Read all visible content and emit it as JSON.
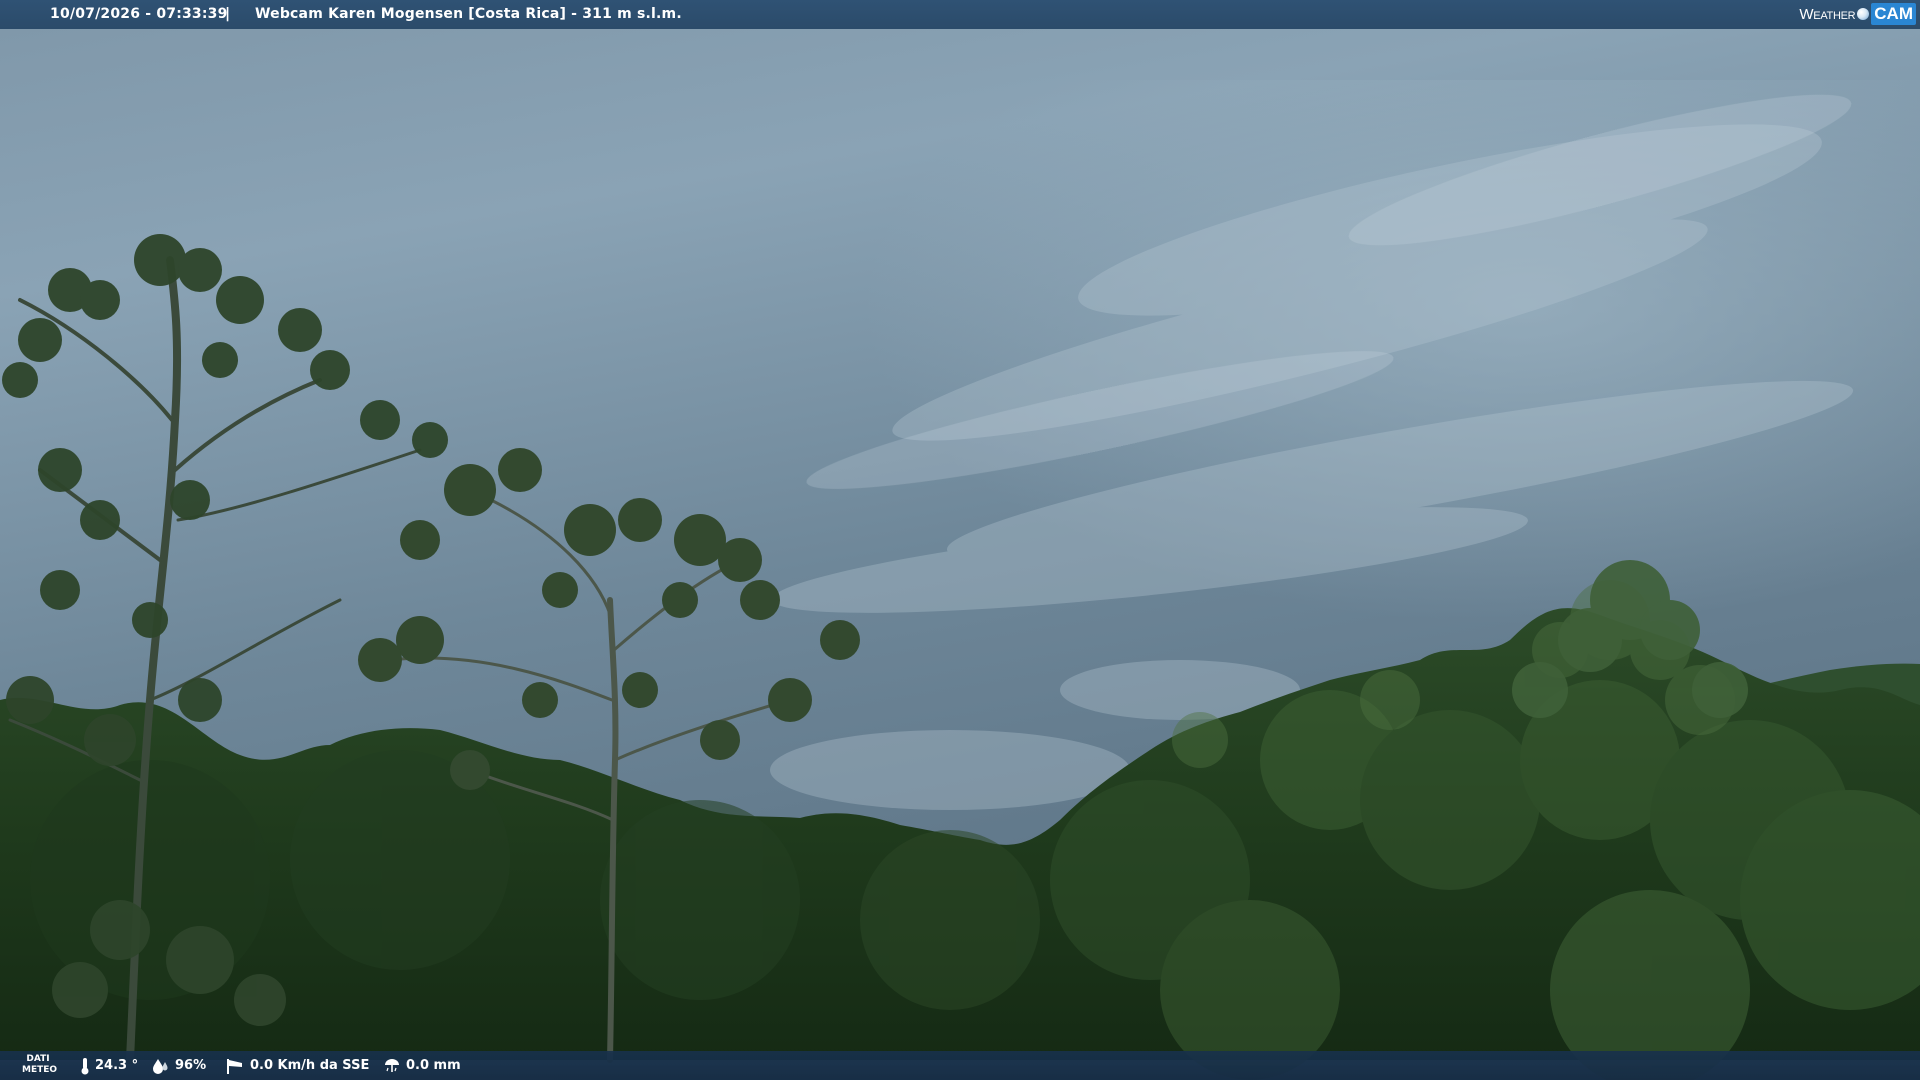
{
  "header": {
    "datetime": "10/07/2026 - 07:33:39",
    "separator": "|",
    "caption": "Webcam Karen Mogensen [Costa Rica]  - 311 m s.l.m.",
    "logo": {
      "word1": "Weather",
      "word2": "CAM"
    }
  },
  "footer": {
    "dati_line1": "DATI",
    "dati_line2": "METEO",
    "temperature": "24.3 °",
    "humidity": "96%",
    "wind": "0.0 Km/h da SSE",
    "rain": "0.0 mm",
    "icons": [
      "thermometer-icon",
      "humidity-drop-icon",
      "wind-sock-icon",
      "rain-gauge-icon"
    ]
  },
  "colors": {
    "bar_bg": "#2b4b6a",
    "logo_accent": "#2a86d3",
    "sky": "#6f8799",
    "foliage": "#1f3a1c"
  }
}
